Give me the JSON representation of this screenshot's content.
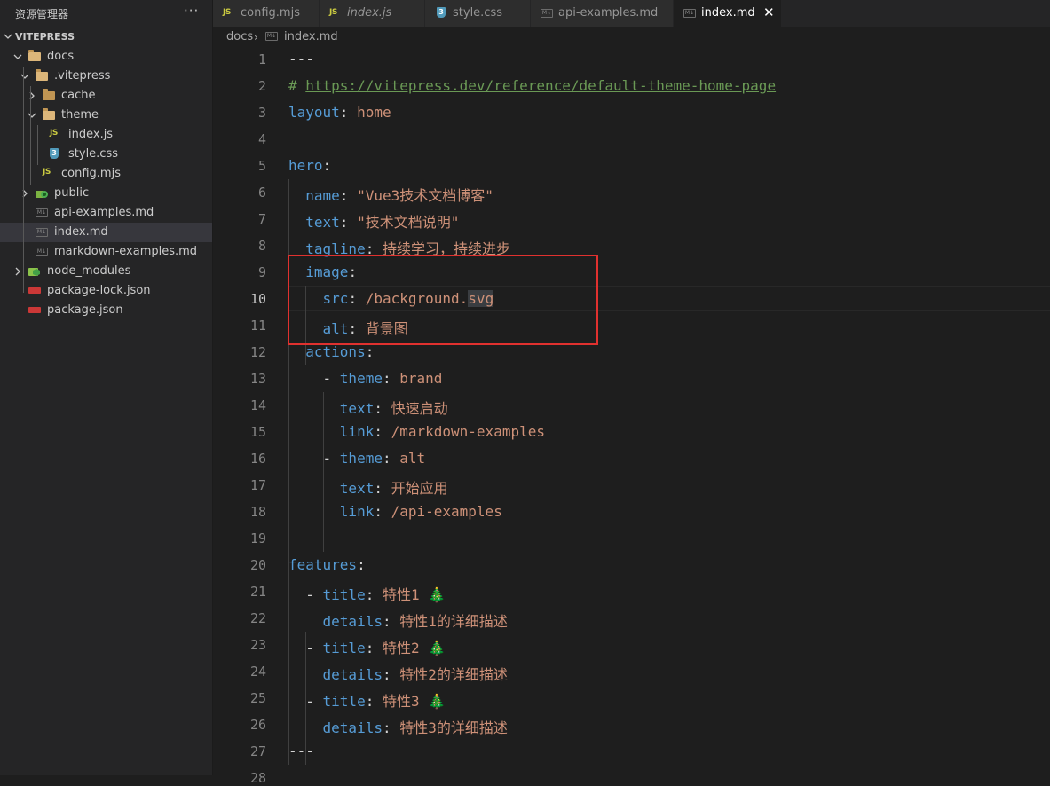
{
  "sidebar": {
    "title": "资源管理器",
    "more": "···",
    "section": "VITEPRESS",
    "tree": [
      {
        "name": "docs",
        "type": "folder-open",
        "depth": 1
      },
      {
        "name": ".vitepress",
        "type": "folder-open",
        "depth": 2
      },
      {
        "name": "cache",
        "type": "folder",
        "depth": 3
      },
      {
        "name": "theme",
        "type": "folder-open",
        "depth": 3
      },
      {
        "name": "index.js",
        "type": "js",
        "depth": 4
      },
      {
        "name": "style.css",
        "type": "css",
        "depth": 4
      },
      {
        "name": "config.mjs",
        "type": "js",
        "depth": 3
      },
      {
        "name": "public",
        "type": "public",
        "depth": 2
      },
      {
        "name": "api-examples.md",
        "type": "md",
        "depth": 2
      },
      {
        "name": "index.md",
        "type": "md",
        "depth": 2,
        "selected": true
      },
      {
        "name": "markdown-examples.md",
        "type": "md",
        "depth": 2
      },
      {
        "name": "node_modules",
        "type": "node",
        "depth": 1
      },
      {
        "name": "package-lock.json",
        "type": "json",
        "depth": 1
      },
      {
        "name": "package.json",
        "type": "json",
        "depth": 1
      }
    ]
  },
  "tabs": [
    {
      "label": "config.mjs",
      "icon": "js"
    },
    {
      "label": "index.js",
      "icon": "js",
      "italic": true
    },
    {
      "label": "style.css",
      "icon": "css"
    },
    {
      "label": "api-examples.md",
      "icon": "md"
    },
    {
      "label": "index.md",
      "icon": "md",
      "active": true,
      "close": "✕"
    }
  ],
  "breadcrumb": {
    "folder": "docs",
    "sep": "›",
    "file": "index.md"
  },
  "editor": {
    "current_line": 10,
    "lines": [
      {
        "n": "1",
        "tokens": [
          [
            "p",
            "---"
          ]
        ]
      },
      {
        "n": "2",
        "tokens": [
          [
            "c",
            "# "
          ],
          [
            "c link",
            "https://vitepress.dev/reference/default-theme-home-page"
          ]
        ]
      },
      {
        "n": "3",
        "tokens": [
          [
            "k",
            "layout"
          ],
          [
            "p",
            ": "
          ],
          [
            "v",
            "home"
          ]
        ]
      },
      {
        "n": "4",
        "tokens": []
      },
      {
        "n": "5",
        "tokens": [
          [
            "k",
            "hero"
          ],
          [
            "p",
            ":"
          ]
        ]
      },
      {
        "n": "6",
        "tokens": [
          [
            "p",
            "  "
          ],
          [
            "k",
            "name"
          ],
          [
            "p",
            ": "
          ],
          [
            "v",
            "\"Vue3技术文档博客\""
          ]
        ]
      },
      {
        "n": "7",
        "tokens": [
          [
            "p",
            "  "
          ],
          [
            "k",
            "text"
          ],
          [
            "p",
            ": "
          ],
          [
            "v",
            "\"技术文档说明\""
          ]
        ]
      },
      {
        "n": "8",
        "tokens": [
          [
            "p",
            "  "
          ],
          [
            "k",
            "tagline"
          ],
          [
            "p",
            ": "
          ],
          [
            "v",
            "持续学习，持续进步"
          ]
        ]
      },
      {
        "n": "9",
        "tokens": [
          [
            "p",
            "  "
          ],
          [
            "k",
            "image"
          ],
          [
            "p",
            ":"
          ]
        ]
      },
      {
        "n": "10",
        "tokens": [
          [
            "p",
            "    "
          ],
          [
            "k",
            "src"
          ],
          [
            "p",
            ": "
          ],
          [
            "v",
            "/background."
          ],
          [
            "v sel",
            "svg"
          ]
        ]
      },
      {
        "n": "11",
        "tokens": [
          [
            "p",
            "    "
          ],
          [
            "k",
            "alt"
          ],
          [
            "p",
            ": "
          ],
          [
            "v",
            "背景图"
          ]
        ]
      },
      {
        "n": "12",
        "tokens": [
          [
            "p",
            "  "
          ],
          [
            "k",
            "actions"
          ],
          [
            "p",
            ":"
          ]
        ]
      },
      {
        "n": "13",
        "tokens": [
          [
            "p",
            "    - "
          ],
          [
            "k",
            "theme"
          ],
          [
            "p",
            ": "
          ],
          [
            "v",
            "brand"
          ]
        ]
      },
      {
        "n": "14",
        "tokens": [
          [
            "p",
            "      "
          ],
          [
            "k",
            "text"
          ],
          [
            "p",
            ": "
          ],
          [
            "v",
            "快速启动"
          ]
        ]
      },
      {
        "n": "15",
        "tokens": [
          [
            "p",
            "      "
          ],
          [
            "k",
            "link"
          ],
          [
            "p",
            ": "
          ],
          [
            "v",
            "/markdown-examples"
          ]
        ]
      },
      {
        "n": "16",
        "tokens": [
          [
            "p",
            "    - "
          ],
          [
            "k",
            "theme"
          ],
          [
            "p",
            ": "
          ],
          [
            "v",
            "alt"
          ]
        ]
      },
      {
        "n": "17",
        "tokens": [
          [
            "p",
            "      "
          ],
          [
            "k",
            "text"
          ],
          [
            "p",
            ": "
          ],
          [
            "v",
            "开始应用"
          ]
        ]
      },
      {
        "n": "18",
        "tokens": [
          [
            "p",
            "      "
          ],
          [
            "k",
            "link"
          ],
          [
            "p",
            ": "
          ],
          [
            "v",
            "/api-examples"
          ]
        ]
      },
      {
        "n": "19",
        "tokens": []
      },
      {
        "n": "20",
        "tokens": [
          [
            "k",
            "features"
          ],
          [
            "p",
            ":"
          ]
        ]
      },
      {
        "n": "21",
        "tokens": [
          [
            "p",
            "  - "
          ],
          [
            "k",
            "title"
          ],
          [
            "p",
            ": "
          ],
          [
            "v",
            "特性1 🎄"
          ]
        ]
      },
      {
        "n": "22",
        "tokens": [
          [
            "p",
            "    "
          ],
          [
            "k",
            "details"
          ],
          [
            "p",
            ": "
          ],
          [
            "v",
            "特性1的详细描述"
          ]
        ]
      },
      {
        "n": "23",
        "tokens": [
          [
            "p",
            "  - "
          ],
          [
            "k",
            "title"
          ],
          [
            "p",
            ": "
          ],
          [
            "v",
            "特性2 🎄"
          ]
        ]
      },
      {
        "n": "24",
        "tokens": [
          [
            "p",
            "    "
          ],
          [
            "k",
            "details"
          ],
          [
            "p",
            ": "
          ],
          [
            "v",
            "特性2的详细描述"
          ]
        ]
      },
      {
        "n": "25",
        "tokens": [
          [
            "p",
            "  - "
          ],
          [
            "k",
            "title"
          ],
          [
            "p",
            ": "
          ],
          [
            "v",
            "特性3 🎄"
          ]
        ]
      },
      {
        "n": "26",
        "tokens": [
          [
            "p",
            "    "
          ],
          [
            "k",
            "details"
          ],
          [
            "p",
            ": "
          ],
          [
            "v",
            "特性3的详细描述"
          ]
        ]
      },
      {
        "n": "27",
        "tokens": [
          [
            "p",
            "---"
          ]
        ]
      },
      {
        "n": "28",
        "tokens": []
      }
    ]
  },
  "colors": {
    "keyword": "#569cd6",
    "string": "#ce9178",
    "comment": "#6a9955",
    "highlight_box": "#e0312f"
  }
}
